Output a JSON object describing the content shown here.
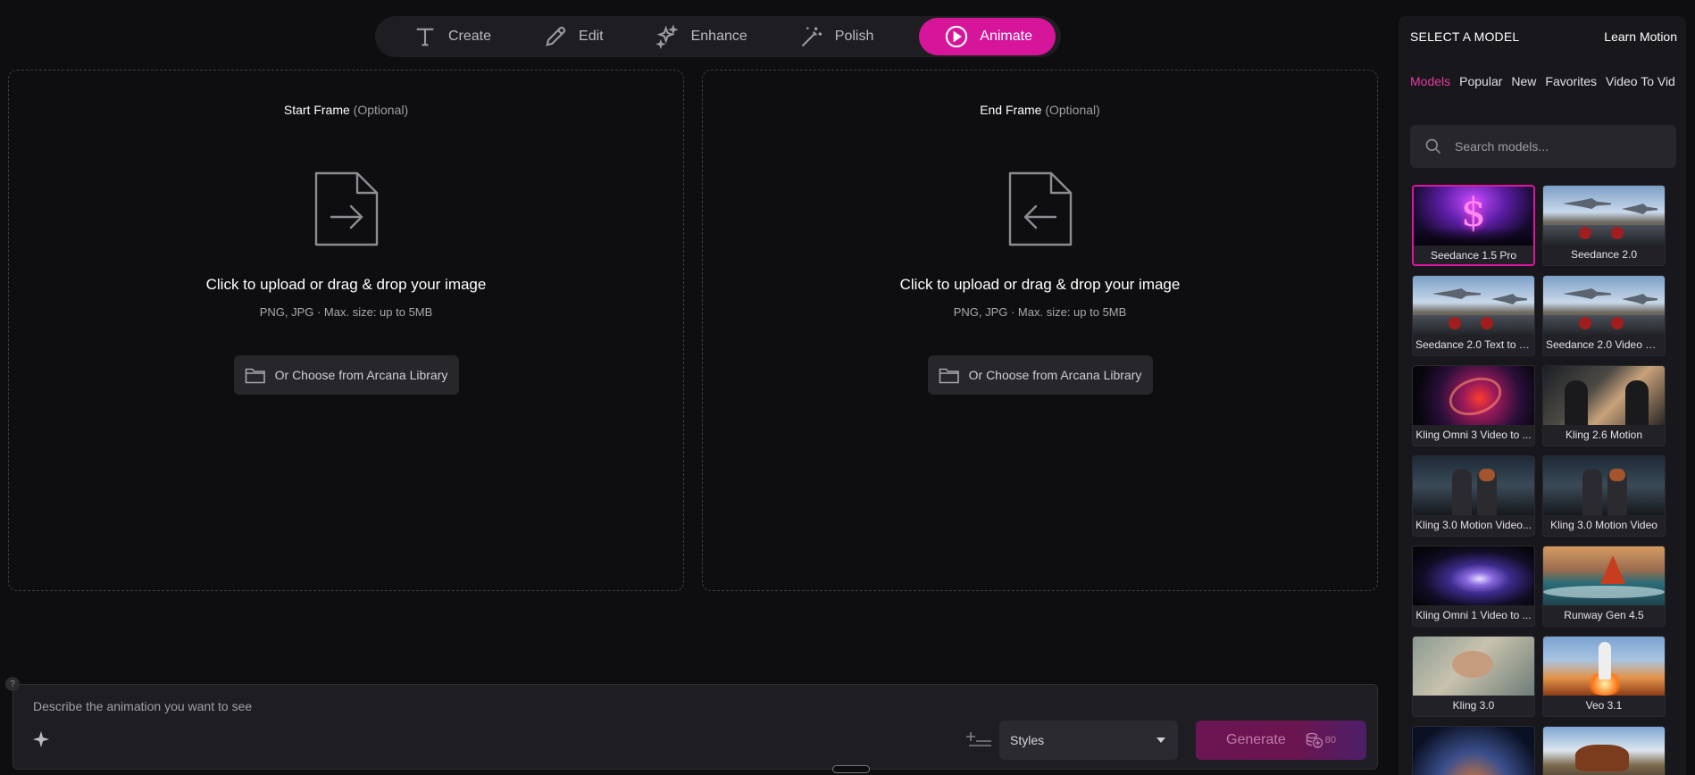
{
  "modes": [
    {
      "label": "Create",
      "icon": "text-t-icon"
    },
    {
      "label": "Edit",
      "icon": "pencil-icon"
    },
    {
      "label": "Enhance",
      "icon": "sparkles-icon"
    },
    {
      "label": "Polish",
      "icon": "magic-wand-icon"
    },
    {
      "label": "Animate",
      "icon": "play-circle-icon",
      "active": true
    }
  ],
  "start_frame": {
    "title": "Start Frame",
    "optional": "(Optional)",
    "upload_text": "Click to upload or drag & drop your image",
    "upload_hint": "PNG, JPG · Max. size: up to 5MB",
    "library_label": "Or Choose from Arcana Library"
  },
  "end_frame": {
    "title": "End Frame",
    "optional": "(Optional)",
    "upload_text": "Click to upload or drag & drop your image",
    "upload_hint": "PNG, JPG · Max. size: up to 5MB",
    "library_label": "Or Choose from Arcana Library"
  },
  "prompt": {
    "help": "?",
    "placeholder": "Describe the animation you want to see",
    "styles_label": "Styles",
    "generate_label": "Generate",
    "credits": "80"
  },
  "sidebar": {
    "title": "SELECT A MODEL",
    "learn_link": "Learn Motion",
    "tabs": [
      "Models",
      "Popular",
      "New",
      "Favorites",
      "Video To Vid"
    ],
    "active_tab": "Models",
    "search_placeholder": "Search models...",
    "models": [
      {
        "name": "Seedance 1.5 Pro",
        "selected": true
      },
      {
        "name": "Seedance 2.0"
      },
      {
        "name": "Seedance 2.0 Text to V..."
      },
      {
        "name": "Seedance 2.0 Video Re..."
      },
      {
        "name": "Kling Omni 3 Video to ..."
      },
      {
        "name": "Kling 2.6 Motion"
      },
      {
        "name": "Kling 3.0 Motion Video..."
      },
      {
        "name": "Kling 3.0 Motion Video"
      },
      {
        "name": "Kling Omni 1 Video to ..."
      },
      {
        "name": "Runway Gen 4.5"
      },
      {
        "name": "Kling 3.0"
      },
      {
        "name": "Veo 3.1"
      },
      {
        "name": ""
      },
      {
        "name": ""
      }
    ]
  },
  "colors": {
    "accent": "#d6159a",
    "accent_text": "#e7389f",
    "background": "#0e0e11",
    "panel": "#1e1e22"
  }
}
